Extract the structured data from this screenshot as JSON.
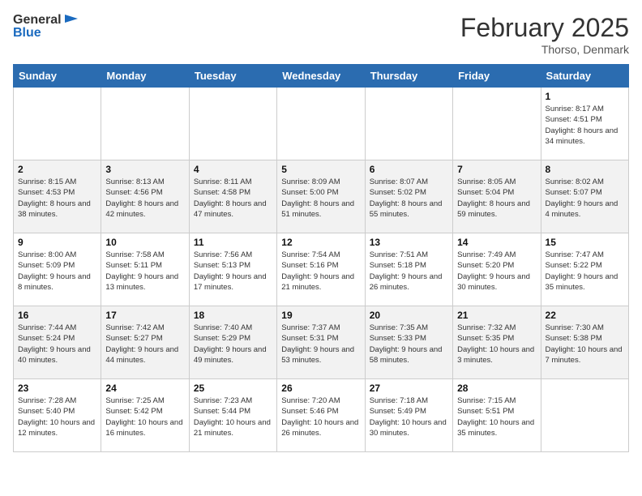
{
  "header": {
    "logo_text_general": "General",
    "logo_text_blue": "Blue",
    "month_title": "February 2025",
    "location": "Thorso, Denmark"
  },
  "days_of_week": [
    "Sunday",
    "Monday",
    "Tuesday",
    "Wednesday",
    "Thursday",
    "Friday",
    "Saturday"
  ],
  "weeks": [
    [
      {
        "day": "",
        "info": ""
      },
      {
        "day": "",
        "info": ""
      },
      {
        "day": "",
        "info": ""
      },
      {
        "day": "",
        "info": ""
      },
      {
        "day": "",
        "info": ""
      },
      {
        "day": "",
        "info": ""
      },
      {
        "day": "1",
        "info": "Sunrise: 8:17 AM\nSunset: 4:51 PM\nDaylight: 8 hours and 34 minutes."
      }
    ],
    [
      {
        "day": "2",
        "info": "Sunrise: 8:15 AM\nSunset: 4:53 PM\nDaylight: 8 hours and 38 minutes."
      },
      {
        "day": "3",
        "info": "Sunrise: 8:13 AM\nSunset: 4:56 PM\nDaylight: 8 hours and 42 minutes."
      },
      {
        "day": "4",
        "info": "Sunrise: 8:11 AM\nSunset: 4:58 PM\nDaylight: 8 hours and 47 minutes."
      },
      {
        "day": "5",
        "info": "Sunrise: 8:09 AM\nSunset: 5:00 PM\nDaylight: 8 hours and 51 minutes."
      },
      {
        "day": "6",
        "info": "Sunrise: 8:07 AM\nSunset: 5:02 PM\nDaylight: 8 hours and 55 minutes."
      },
      {
        "day": "7",
        "info": "Sunrise: 8:05 AM\nSunset: 5:04 PM\nDaylight: 8 hours and 59 minutes."
      },
      {
        "day": "8",
        "info": "Sunrise: 8:02 AM\nSunset: 5:07 PM\nDaylight: 9 hours and 4 minutes."
      }
    ],
    [
      {
        "day": "9",
        "info": "Sunrise: 8:00 AM\nSunset: 5:09 PM\nDaylight: 9 hours and 8 minutes."
      },
      {
        "day": "10",
        "info": "Sunrise: 7:58 AM\nSunset: 5:11 PM\nDaylight: 9 hours and 13 minutes."
      },
      {
        "day": "11",
        "info": "Sunrise: 7:56 AM\nSunset: 5:13 PM\nDaylight: 9 hours and 17 minutes."
      },
      {
        "day": "12",
        "info": "Sunrise: 7:54 AM\nSunset: 5:16 PM\nDaylight: 9 hours and 21 minutes."
      },
      {
        "day": "13",
        "info": "Sunrise: 7:51 AM\nSunset: 5:18 PM\nDaylight: 9 hours and 26 minutes."
      },
      {
        "day": "14",
        "info": "Sunrise: 7:49 AM\nSunset: 5:20 PM\nDaylight: 9 hours and 30 minutes."
      },
      {
        "day": "15",
        "info": "Sunrise: 7:47 AM\nSunset: 5:22 PM\nDaylight: 9 hours and 35 minutes."
      }
    ],
    [
      {
        "day": "16",
        "info": "Sunrise: 7:44 AM\nSunset: 5:24 PM\nDaylight: 9 hours and 40 minutes."
      },
      {
        "day": "17",
        "info": "Sunrise: 7:42 AM\nSunset: 5:27 PM\nDaylight: 9 hours and 44 minutes."
      },
      {
        "day": "18",
        "info": "Sunrise: 7:40 AM\nSunset: 5:29 PM\nDaylight: 9 hours and 49 minutes."
      },
      {
        "day": "19",
        "info": "Sunrise: 7:37 AM\nSunset: 5:31 PM\nDaylight: 9 hours and 53 minutes."
      },
      {
        "day": "20",
        "info": "Sunrise: 7:35 AM\nSunset: 5:33 PM\nDaylight: 9 hours and 58 minutes."
      },
      {
        "day": "21",
        "info": "Sunrise: 7:32 AM\nSunset: 5:35 PM\nDaylight: 10 hours and 3 minutes."
      },
      {
        "day": "22",
        "info": "Sunrise: 7:30 AM\nSunset: 5:38 PM\nDaylight: 10 hours and 7 minutes."
      }
    ],
    [
      {
        "day": "23",
        "info": "Sunrise: 7:28 AM\nSunset: 5:40 PM\nDaylight: 10 hours and 12 minutes."
      },
      {
        "day": "24",
        "info": "Sunrise: 7:25 AM\nSunset: 5:42 PM\nDaylight: 10 hours and 16 minutes."
      },
      {
        "day": "25",
        "info": "Sunrise: 7:23 AM\nSunset: 5:44 PM\nDaylight: 10 hours and 21 minutes."
      },
      {
        "day": "26",
        "info": "Sunrise: 7:20 AM\nSunset: 5:46 PM\nDaylight: 10 hours and 26 minutes."
      },
      {
        "day": "27",
        "info": "Sunrise: 7:18 AM\nSunset: 5:49 PM\nDaylight: 10 hours and 30 minutes."
      },
      {
        "day": "28",
        "info": "Sunrise: 7:15 AM\nSunset: 5:51 PM\nDaylight: 10 hours and 35 minutes."
      },
      {
        "day": "",
        "info": ""
      }
    ]
  ]
}
